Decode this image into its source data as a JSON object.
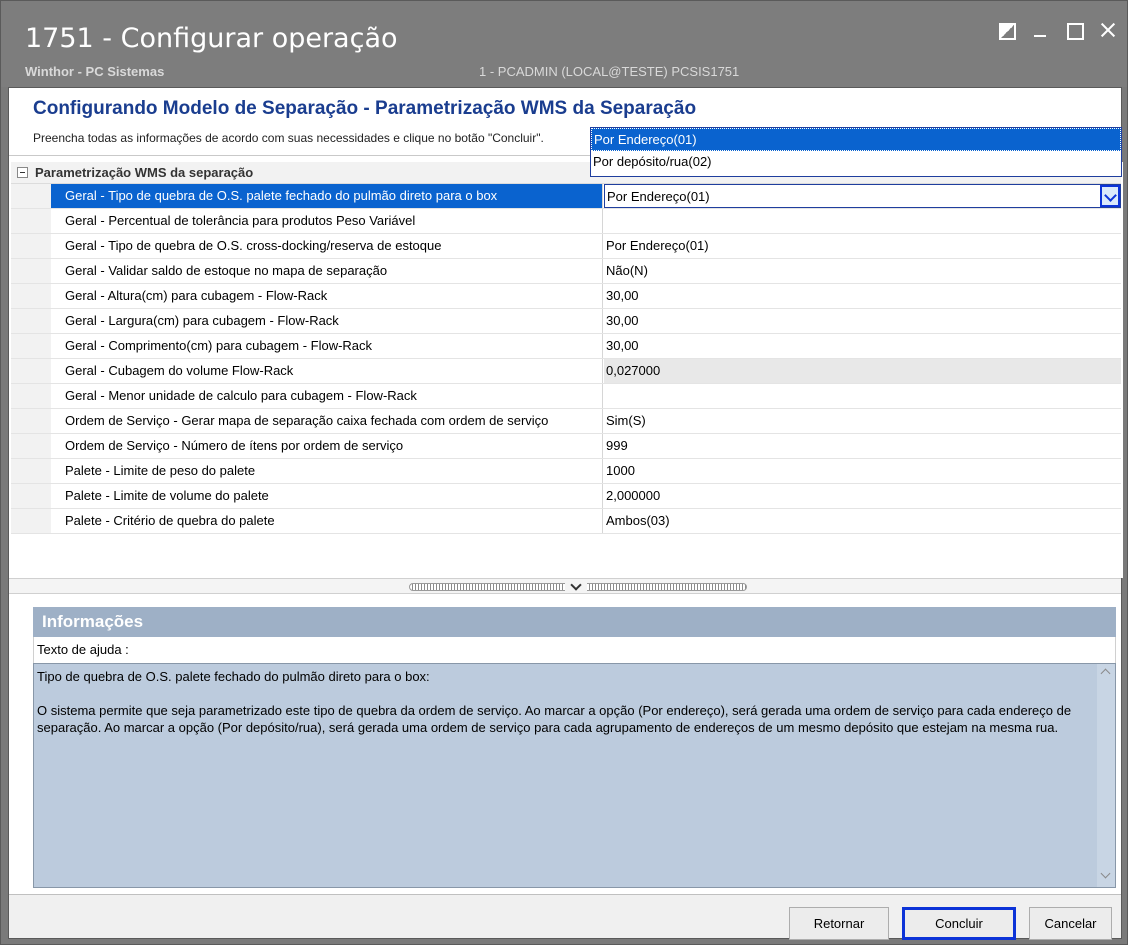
{
  "window": {
    "title": "1751 - Configurar operação",
    "app_name": "Winthor - PC Sistemas",
    "session_info": "1 - PCADMIN (LOCAL@TESTE)   PCSIS1751"
  },
  "wizard": {
    "title": "Configurando Modelo de Separação - Parametrização WMS da Separação",
    "description": "Preencha todas as informações de acordo com suas necessidades e clique no botão \"Concluir\"."
  },
  "grid": {
    "category": "Parametrização WMS da separação",
    "rows": [
      {
        "name": "Geral - Tipo de quebra de O.S. palete fechado do pulmão direto para o box",
        "value": "Por Endereço(01)"
      },
      {
        "name": "Geral - Percentual de tolerância para produtos Peso Variável",
        "value": ""
      },
      {
        "name": "Geral - Tipo de quebra de O.S. cross-docking/reserva de estoque",
        "value": "Por Endereço(01)"
      },
      {
        "name": "Geral - Validar saldo de estoque no mapa de separação",
        "value": "Não(N)"
      },
      {
        "name": "Geral - Altura(cm) para cubagem - Flow-Rack",
        "value": "30,00"
      },
      {
        "name": "Geral - Largura(cm) para cubagem - Flow-Rack",
        "value": "30,00"
      },
      {
        "name": "Geral - Comprimento(cm) para cubagem - Flow-Rack",
        "value": "30,00"
      },
      {
        "name": "Geral - Cubagem do volume Flow-Rack",
        "value": "0,027000"
      },
      {
        "name": "Geral - Menor unidade de calculo para cubagem - Flow-Rack",
        "value": ""
      },
      {
        "name": "Ordem de Serviço - Gerar mapa de separação caixa fechada com ordem de serviço",
        "value": "Sim(S)"
      },
      {
        "name": "Ordem de Serviço - Número de ítens por ordem de serviço",
        "value": "999"
      },
      {
        "name": "Palete - Limite de peso do palete",
        "value": "1000"
      },
      {
        "name": "Palete - Limite de volume do palete",
        "value": "2,000000"
      },
      {
        "name": "Palete - Critério de quebra do palete",
        "value": "Ambos(03)"
      }
    ],
    "dropdown_options": [
      "Por Endereço(01)",
      "Por depósito/rua(02)"
    ]
  },
  "info": {
    "header": "Informações",
    "help_label": "Texto de ajuda :",
    "help_paragraph_1": "Tipo de quebra de O.S. palete fechado do pulmão direto para o box:",
    "help_paragraph_2": "O sistema permite que seja parametrizado este tipo de quebra da ordem de serviço. Ao marcar a opção (Por endereço), será gerada uma ordem de serviço para cada endereço de separação. Ao marcar a opção (Por depósito/rua), será gerada uma ordem de serviço para cada agrupamento de endereços de um mesmo depósito que estejam na mesma rua."
  },
  "buttons": {
    "retornar": "Retornar",
    "concluir": "Concluir",
    "cancelar": "Cancelar"
  },
  "colors": {
    "title_bar": "#7d7d7d",
    "wizard_title": "#1a3d8f",
    "selection": "#0a63cf",
    "focus_border": "#0c33d8",
    "info_header": "#9eb0c6",
    "help_box": "#bccbdd"
  },
  "icons": [
    "restore-icon",
    "minimize-icon",
    "maximize-icon",
    "close-icon",
    "collapse-icon",
    "dropdown-arrow-icon",
    "splitter-chevron-icon"
  ]
}
